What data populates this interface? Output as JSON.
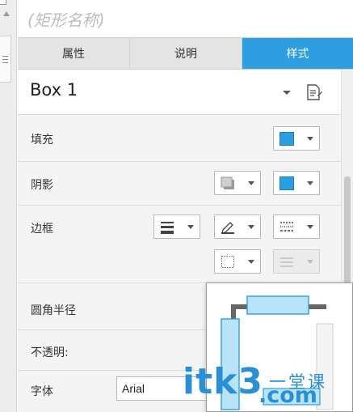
{
  "panel": {
    "name_placeholder": "(矩形名称)",
    "tabs": [
      {
        "label": "属性",
        "active": false
      },
      {
        "label": "说明",
        "active": false
      },
      {
        "label": "样式",
        "active": true
      }
    ],
    "style_name": "Box 1",
    "accent_color": "#2d9fe0"
  },
  "rows": {
    "fill": {
      "label": "填充",
      "swatch_color": "#2d9fe0"
    },
    "shadow": {
      "label": "阴影",
      "shadow_color": "#2d9fe0"
    },
    "border": {
      "label": "边框"
    },
    "corner_radius": {
      "label": "圆角半径"
    },
    "opacity": {
      "label": "不透明:"
    },
    "font": {
      "label": "字体",
      "value": "Arial"
    }
  },
  "watermark": {
    "text": "itk3",
    "text2": ".com",
    "cn_text": "一堂课",
    "color": "#2b8fd6"
  }
}
